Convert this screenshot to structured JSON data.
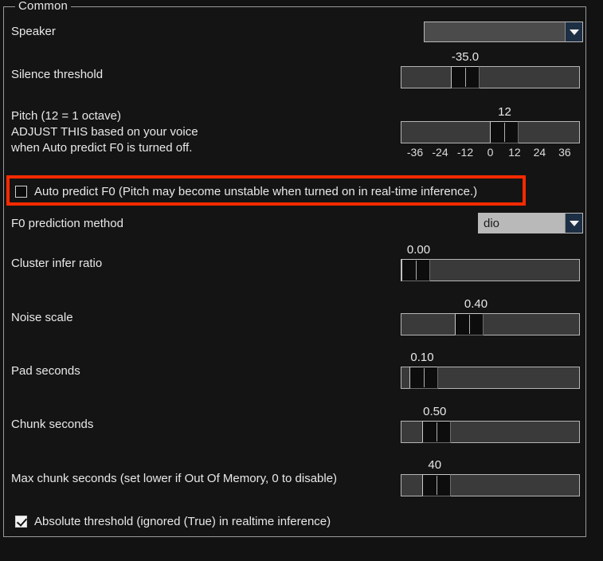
{
  "group": {
    "title": "Common"
  },
  "colors": {
    "annotation": "#f92a00",
    "background": "#121212",
    "text": "#e8e8e8",
    "track": "#3a3a3a",
    "combo_arrow": "#1d2f44"
  },
  "speaker": {
    "label": "Speaker",
    "value": "",
    "placeholder": ""
  },
  "silence_threshold": {
    "label": "Silence threshold",
    "value": "-35.0",
    "fill_pct": 36
  },
  "pitch": {
    "label_line1": "Pitch (12 = 1 octave)",
    "label_line2": "ADJUST THIS based on your voice",
    "label_line3": "when Auto predict F0 is turned off.",
    "value": "12",
    "fill_pct": 58,
    "ticks": [
      "-36",
      "-24",
      "-12",
      "0",
      "12",
      "24",
      "36"
    ]
  },
  "auto_predict_f0": {
    "label": "Auto predict F0 (Pitch may become unstable when turned on in real-time inference.)",
    "checked": false
  },
  "f0_prediction_method": {
    "label": "F0 prediction method",
    "value": "dio"
  },
  "cluster_infer_ratio": {
    "label": "Cluster infer ratio",
    "value": "0.00",
    "fill_pct": 1
  },
  "noise_scale": {
    "label": "Noise scale",
    "value": "0.40",
    "fill_pct": 38
  },
  "pad_seconds": {
    "label": "Pad seconds",
    "value": "0.10",
    "fill_pct": 8
  },
  "chunk_seconds": {
    "label": "Chunk seconds",
    "value": "0.50",
    "fill_pct": 16
  },
  "max_chunk_seconds": {
    "label": "Max chunk seconds (set lower if Out Of Memory, 0 to disable)",
    "value": "40",
    "fill_pct": 16
  },
  "absolute_threshold": {
    "label": "Absolute threshold (ignored (True) in realtime inference)",
    "checked": true
  }
}
